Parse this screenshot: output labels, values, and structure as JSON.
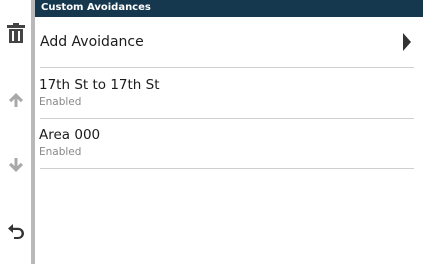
{
  "header": {
    "title": "Custom Avoidances"
  },
  "list": {
    "add_label": "Add Avoidance",
    "items": [
      {
        "name": "17th St to 17th St",
        "status": "Enabled"
      },
      {
        "name": "Area 000",
        "status": "Enabled"
      }
    ]
  },
  "sidebar": {
    "icons": [
      "trash-icon",
      "arrow-up-icon",
      "arrow-down-icon",
      "back-icon"
    ]
  },
  "colors": {
    "titlebar": "#16384e",
    "sidebar_border": "#b9b9b9",
    "icon": "#5a5a5a"
  }
}
